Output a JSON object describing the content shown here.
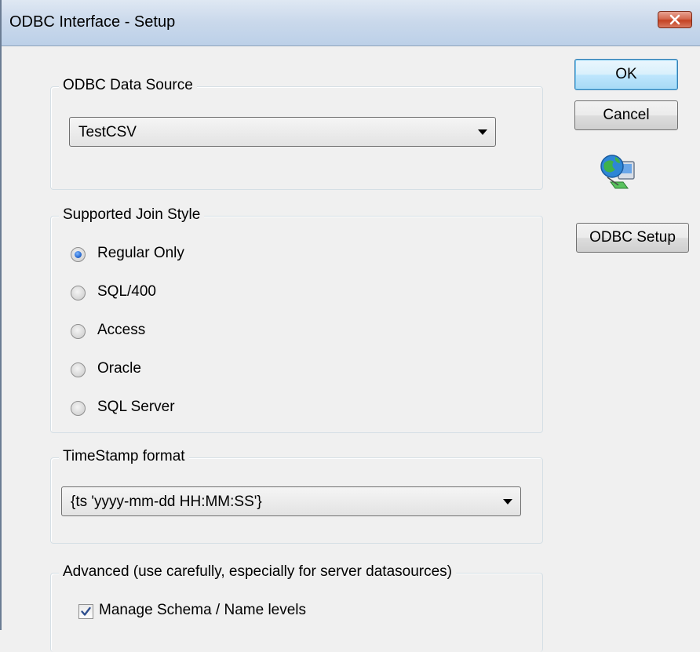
{
  "window": {
    "title": "ODBC Interface - Setup"
  },
  "buttons": {
    "ok": "OK",
    "cancel": "Cancel",
    "odbc_setup": "ODBC Setup"
  },
  "data_source": {
    "group_label": "ODBC Data Source",
    "selected": "TestCSV"
  },
  "join_style": {
    "group_label": "Supported Join Style",
    "options": [
      {
        "label": "Regular Only",
        "checked": true
      },
      {
        "label": "SQL/400",
        "checked": false
      },
      {
        "label": "Access",
        "checked": false
      },
      {
        "label": "Oracle",
        "checked": false
      },
      {
        "label": "SQL Server",
        "checked": false
      }
    ]
  },
  "timestamp": {
    "group_label": "TimeStamp format",
    "selected": "{ts 'yyyy-mm-dd HH:MM:SS'}"
  },
  "advanced": {
    "group_label": "Advanced (use carefully, especially for server datasources)",
    "manage_schema_label": "Manage Schema / Name levels",
    "manage_schema_checked": true
  },
  "icons": {
    "close": "close-icon",
    "network": "network-globe-icon"
  },
  "colors": {
    "dialog_bg": "#f0f0f0",
    "titlebar": "#c9d8eb",
    "close_button": "#c44222",
    "default_button_border": "#3c7fb1"
  }
}
